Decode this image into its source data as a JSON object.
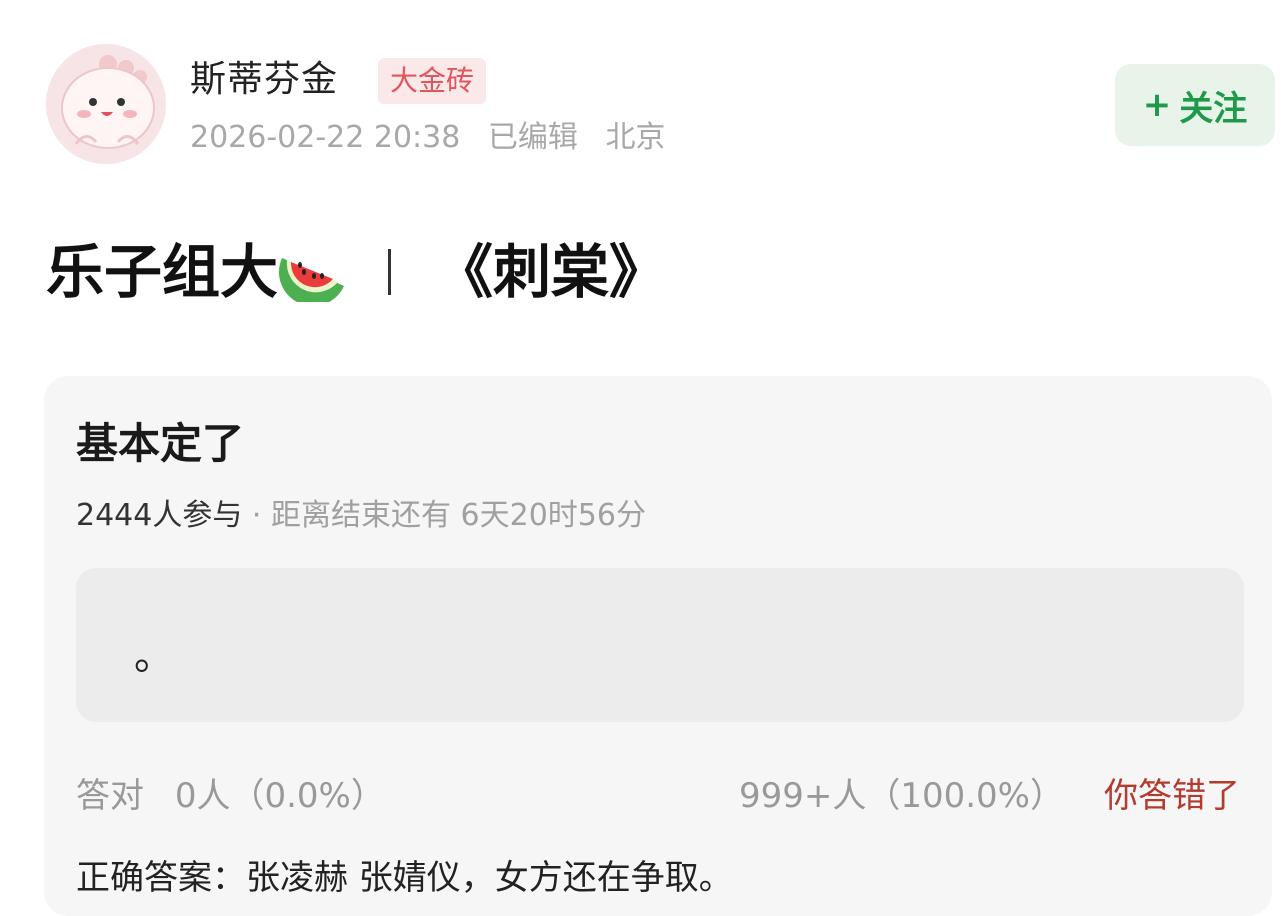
{
  "author": {
    "name": "斯蒂芬金",
    "badge": "大金砖",
    "timestamp": "2026-02-22 20:38",
    "edited": "已编辑",
    "location": "北京",
    "avatar_icon": "cartoon-avatar-icon"
  },
  "follow": {
    "plus": "+",
    "label": "关注",
    "color": "#1f9a4a"
  },
  "post": {
    "title_left": "乐子组大",
    "title_emoji": "🍉",
    "title_right": "《刺棠》"
  },
  "quiz": {
    "title": "基本定了",
    "participants": "2444人参与",
    "dot": "·",
    "deadline": "距离结束还有 6天20时56分",
    "option": "。",
    "correct_label": "答对",
    "correct_count": "0人（0.0%）",
    "wrong_count": "999+人（100.0%）",
    "wrong_label": "你答错了",
    "answer": "正确答案：张凌赫 张婧仪，女方还在争取。"
  },
  "colors": {
    "badge_text": "#e0565d",
    "wrong": "#b33a2f"
  }
}
